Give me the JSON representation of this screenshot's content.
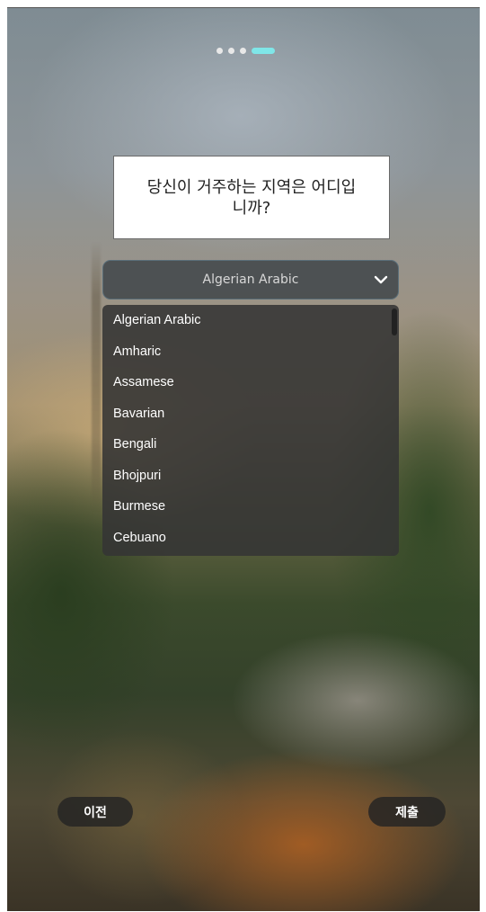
{
  "progress": {
    "total_steps": 4,
    "current_step": 4
  },
  "question": {
    "text": "당신이 거주하는 지역은 어디입니까?"
  },
  "select": {
    "value": "Algerian Arabic",
    "icon": "chevron-down-icon"
  },
  "options": [
    "Algerian Arabic",
    "Amharic",
    "Assamese",
    "Bavarian",
    "Bengali",
    "Bhojpuri",
    "Burmese",
    "Cebuano"
  ],
  "buttons": {
    "prev_label": "이전",
    "submit_label": "제출"
  },
  "colors": {
    "pager_active": "#7fe6e8",
    "pager_inactive": "#e8e8e8",
    "button_bg": "#232323"
  }
}
